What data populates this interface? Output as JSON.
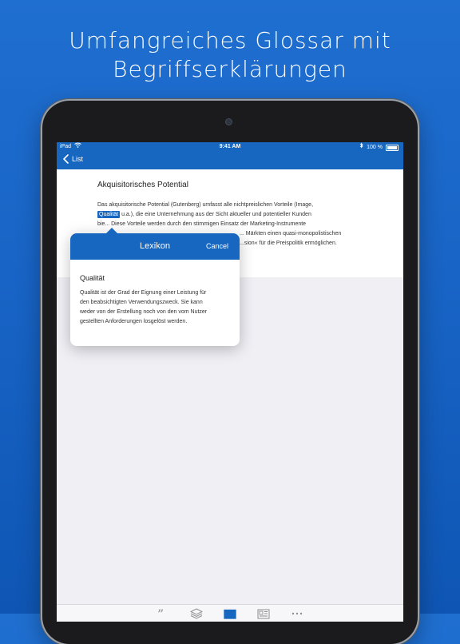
{
  "headline": {
    "line1": "Umfangreiches Glossar mit",
    "line2": "Begriffserklärungen"
  },
  "status_bar": {
    "device": "iPad",
    "time": "9:41 AM",
    "battery": "100 %"
  },
  "nav": {
    "back_label": "List"
  },
  "article": {
    "title": "Akquisitorisches Potential",
    "line1": "Das akquisitorische Potential (Gutenberg) umfasst alle nichtpreislichen Vorteile (Image,",
    "line2_highlight": "Qualität",
    "line2_rest": " u.a.), die eine Unternehmung aus der Sicht aktueller und potentieller Kunden",
    "line3": "bie... Diese Vorteile werden durch den stimmigen Einsatz der Marketing-Instrumente",
    "line4": "... Märkten einen quasi-monopolistischen",
    "line5": "...sion« für die Preispolitik ermöglichen."
  },
  "popover": {
    "title": "Lexikon",
    "cancel_label": "Cancel",
    "term": "Qualität",
    "definition_lines": [
      "Qualität ist der Grad der Eignung einer Leistung für",
      "den beabsichtigten Verwendungszweck. Sie kann",
      "weder von der Erstellung noch von den vom Nutzer",
      "gestellten Anforderungen losgelöst werden."
    ]
  },
  "tabbar": {
    "items": [
      "quote-icon",
      "layers-icon",
      "book-icon",
      "newspaper-icon",
      "more-icon"
    ],
    "active": "book-icon"
  },
  "colors": {
    "accent": "#1766c0",
    "background": "#1864c6"
  }
}
